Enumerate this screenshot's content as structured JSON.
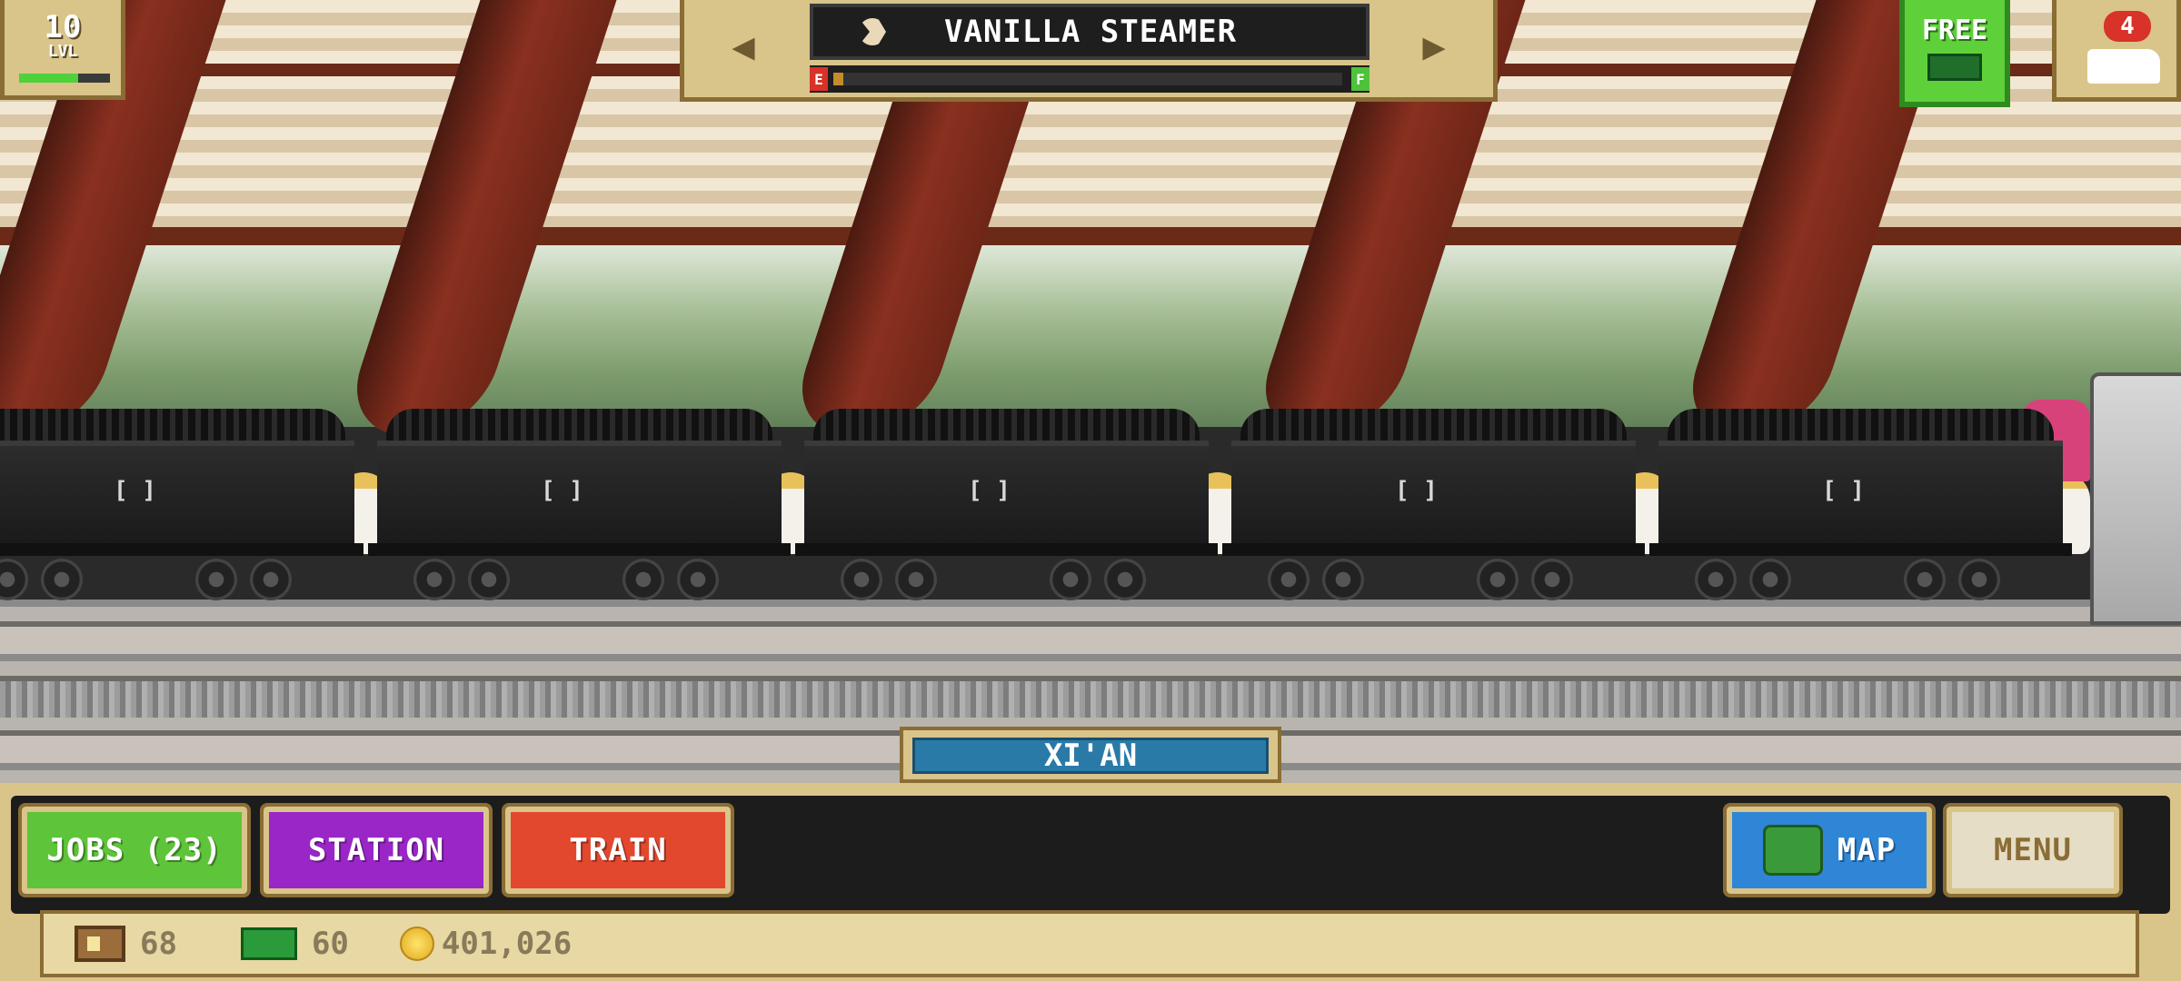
{
  "hud": {
    "level": {
      "value": "10",
      "label": "LVL",
      "progress": 0.65
    },
    "train_selector": {
      "prev_icon": "left-arrow-icon",
      "next_icon": "right-arrow-icon",
      "train_name": "VANILLA STEAMER",
      "fuel_empty_label": "E",
      "fuel_full_label": "F",
      "fuel_level": 0.02
    },
    "free_button": {
      "label": "FREE",
      "icon": "cash-icon"
    },
    "tickets": {
      "count": "4",
      "icon": "locomotive-icon"
    }
  },
  "station": {
    "name": "XI'AN"
  },
  "nav": {
    "jobs_label": "JOBS (23)",
    "station_label": "STATION",
    "train_label": "TRAIN",
    "map_label": "MAP",
    "menu_label": "MENU"
  },
  "stats": {
    "tickets": "68",
    "cash": "60",
    "coins": "401,026"
  },
  "colors": {
    "jobs": "#5ec43a",
    "station": "#9a26c8",
    "train": "#e2482e",
    "map": "#2f86d6",
    "free": "#5ed13a"
  }
}
